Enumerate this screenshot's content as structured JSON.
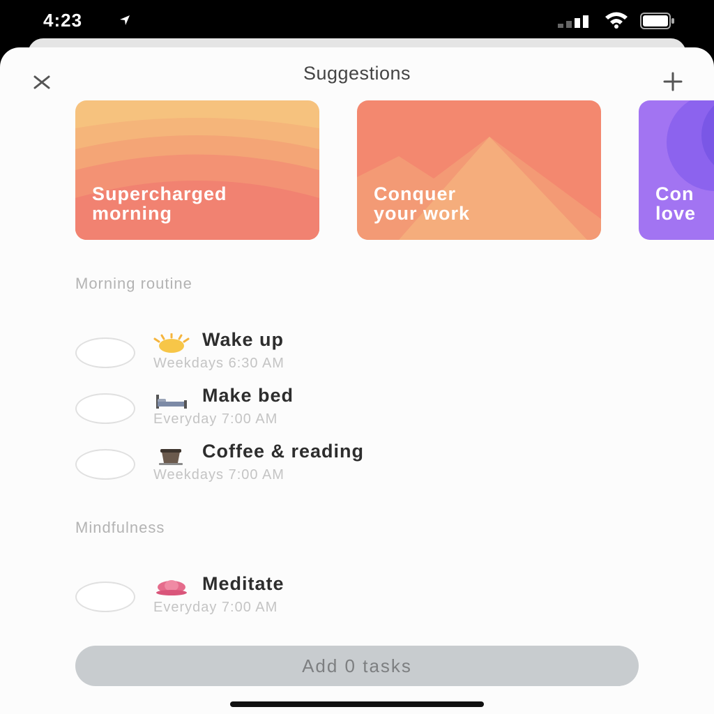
{
  "status_bar": {
    "time": "4:23"
  },
  "header": {
    "title": "Suggestions"
  },
  "cards": [
    {
      "title_line1": "Supercharged",
      "title_line2": "morning"
    },
    {
      "title_line1": "Conquer",
      "title_line2": "your work"
    },
    {
      "title_line1": "Con",
      "title_line2": "love"
    }
  ],
  "sections": [
    {
      "label": "Morning routine",
      "tasks": [
        {
          "icon": "sun-icon",
          "name": "Wake up",
          "schedule": "Weekdays 6:30 AM"
        },
        {
          "icon": "bed-icon",
          "name": "Make bed",
          "schedule": "Everyday 7:00 AM"
        },
        {
          "icon": "coffee-icon",
          "name": "Coffee & reading",
          "schedule": "Weekdays 7:00 AM"
        }
      ]
    },
    {
      "label": "Mindfulness",
      "tasks": [
        {
          "icon": "lotus-icon",
          "name": "Meditate",
          "schedule": "Everyday 7:00 AM"
        }
      ]
    }
  ],
  "footer": {
    "button_label": "Add 0 tasks"
  },
  "colors": {
    "card1": "#f4a879",
    "card2": "#f28c72",
    "card3": "#a070f0",
    "button_bg": "#c8cccf"
  }
}
